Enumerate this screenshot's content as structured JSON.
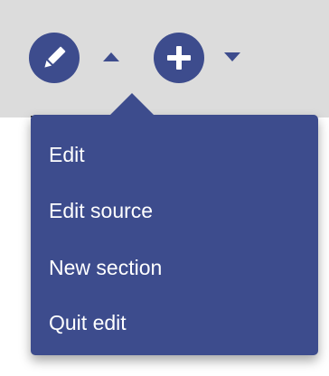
{
  "toolbar": {
    "edit_icon": "pencil-icon",
    "edit_caret_icon": "caret-up-icon",
    "add_icon": "plus-icon",
    "add_caret_icon": "caret-down-icon"
  },
  "menu": {
    "items": [
      {
        "label": "Edit"
      },
      {
        "label": "Edit source"
      },
      {
        "label": "New section"
      },
      {
        "label": "Quit edit"
      }
    ]
  },
  "colors": {
    "accent": "#3d4c8d",
    "toolbar_bg": "#dcdcdc",
    "menu_text": "#ffffff"
  }
}
